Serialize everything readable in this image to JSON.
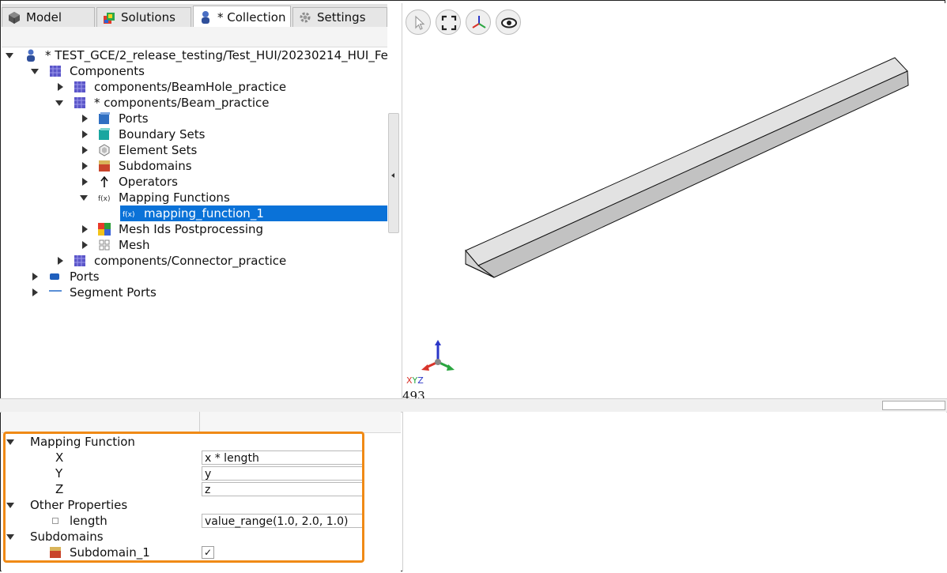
{
  "tabs": [
    {
      "label": "Model"
    },
    {
      "label": "Solutions"
    },
    {
      "label": "* Collection"
    },
    {
      "label": "Settings"
    }
  ],
  "tree": {
    "root": "* TEST_GCE/2_release_testing/Test_HUI/20230214_HUI_Fe",
    "components": "Components",
    "beamhole": "components/BeamHole_practice",
    "beam": "* components/Beam_practice",
    "ports_inner": "Ports",
    "boundary_sets": "Boundary Sets",
    "element_sets": "Element Sets",
    "subdomains": "Subdomains",
    "operators": "Operators",
    "mapping_functions": "Mapping Functions",
    "mapping_function_1": "mapping_function_1",
    "mesh_ids": "Mesh Ids Postprocessing",
    "mesh": "Mesh",
    "connector": "components/Connector_practice",
    "ports": "Ports",
    "segment_ports": "Segment Ports"
  },
  "viewport": {
    "axis_labels": {
      "x": "X",
      "y": "Y",
      "z": "Z"
    },
    "counter": "493"
  },
  "properties": {
    "mapping_function": {
      "heading": "Mapping Function",
      "x_label": "X",
      "x_value": "x * length",
      "y_label": "Y",
      "y_value": "y",
      "z_label": "Z",
      "z_value": "z"
    },
    "other": {
      "heading": "Other Properties",
      "length_label": "length",
      "length_value": "value_range(1.0, 2.0, 1.0)"
    },
    "subdomains": {
      "heading": "Subdomains",
      "sub1_label": "Subdomain_1",
      "sub1_checked": "✓"
    }
  },
  "colors": {
    "selection": "#0a72d8",
    "highlight_border": "#f08a16"
  }
}
